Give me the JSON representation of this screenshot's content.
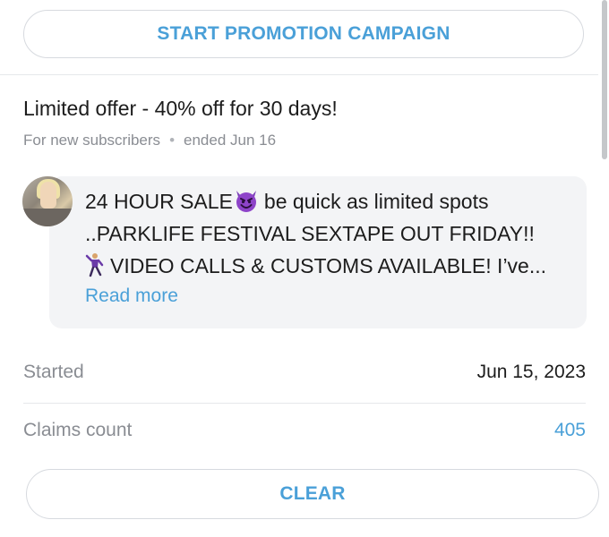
{
  "promotion": {
    "start_label": "START PROMOTION CAMPAIGN",
    "title": "Limited offer - 40% off for 30 days!",
    "audience": "For new subscribers",
    "separator": "•",
    "status": "ended Jun 16"
  },
  "message": {
    "line1_a": "24 HOUR SALE",
    "line1_b": "be quick as limited spots",
    "line2": "..PARKLIFE FESTIVAL SEXTAPE OUT FRIDAY!!",
    "line3": "VIDEO CALLS & CUSTOMS AVAILABLE! I’ve...",
    "read_more": "Read more",
    "emoji_1": "smiling-devil-icon",
    "emoji_2": "dancing-man-icon"
  },
  "details": {
    "started_label": "Started",
    "started_value": "Jun 15, 2023",
    "claims_label": "Claims count",
    "claims_value": "405"
  },
  "footer": {
    "clear_label": "CLEAR"
  },
  "colors": {
    "accent": "#4aa0d8",
    "muted": "#8a8d93",
    "bubble": "#f3f4f6"
  }
}
